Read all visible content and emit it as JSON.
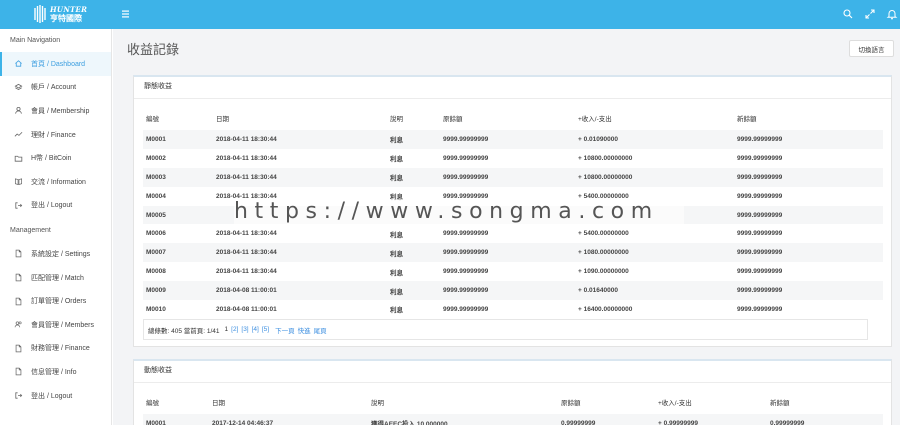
{
  "brand": {
    "name_en": "HUNTER",
    "name_zh": "亨特國際"
  },
  "nav": {
    "section_main": "Main Navigation",
    "section_management": "Management",
    "main_items": [
      {
        "label": "首頁 / Dashboard",
        "icon": "home-icon"
      },
      {
        "label": "帳戶 / Account",
        "icon": "layers-icon"
      },
      {
        "label": "會員 / Membership",
        "icon": "user-icon"
      },
      {
        "label": "理財 / Finance",
        "icon": "trend-icon"
      },
      {
        "label": "H幣 / BitCoin",
        "icon": "folder-icon"
      },
      {
        "label": "交流 / Information",
        "icon": "book-icon"
      },
      {
        "label": "登出 / Logout",
        "icon": "logout-icon"
      }
    ],
    "mgmt_items": [
      {
        "label": "系統設定 / Settings",
        "icon": "file-icon"
      },
      {
        "label": "匹配管理 / Match",
        "icon": "file-icon"
      },
      {
        "label": "訂單管理 / Orders",
        "icon": "file-icon"
      },
      {
        "label": "會員管理 / Members",
        "icon": "people-icon"
      },
      {
        "label": "財務管理 / Finance",
        "icon": "file-icon"
      },
      {
        "label": "信息管理 / Info",
        "icon": "file-icon"
      },
      {
        "label": "登出 / Logout",
        "icon": "logout-icon"
      }
    ]
  },
  "page": {
    "title": "收益記錄",
    "lang_button": "切換語言"
  },
  "static_panel": {
    "title": "靜態收益",
    "headers": [
      "編號",
      "日期",
      "說明",
      "原餘額",
      "+收入/-支出",
      "新餘額"
    ],
    "rows": [
      [
        "M0001",
        "2018-04-11 18:30:44",
        "利息",
        "9999.99999999",
        "+ 0.01090000",
        "9999.99999999"
      ],
      [
        "M0002",
        "2018-04-11 18:30:44",
        "利息",
        "9999.99999999",
        "+ 10800.00000000",
        "9999.99999999"
      ],
      [
        "M0003",
        "2018-04-11 18:30:44",
        "利息",
        "9999.99999999",
        "+ 10800.00000000",
        "9999.99999999"
      ],
      [
        "M0004",
        "2018-04-11 18:30:44",
        "利息",
        "9999.99999999",
        "+ 5400.00000000",
        "9999.99999999"
      ],
      [
        "M0005",
        "",
        "",
        "",
        "",
        "9999.99999999"
      ],
      [
        "M0006",
        "2018-04-11 18:30:44",
        "利息",
        "9999.99999999",
        "+ 5400.00000000",
        "9999.99999999"
      ],
      [
        "M0007",
        "2018-04-11 18:30:44",
        "利息",
        "9999.99999999",
        "+ 1080.00000000",
        "9999.99999999"
      ],
      [
        "M0008",
        "2018-04-11 18:30:44",
        "利息",
        "9999.99999999",
        "+ 1090.00000000",
        "9999.99999999"
      ],
      [
        "M0009",
        "2018-04-08 11:00:01",
        "利息",
        "9999.99999999",
        "+ 0.01640000",
        "9999.99999999"
      ],
      [
        "M0010",
        "2018-04-08 11:00:01",
        "利息",
        "9999.99999999",
        "+ 16400.00000000",
        "9999.99999999"
      ]
    ],
    "pager": {
      "summary": "總條數: 405 當前頁: 1/41",
      "current": "1",
      "pages": [
        "[2]",
        "[3]",
        "[4]",
        "[5]"
      ],
      "next": "下一頁",
      "fast": "快進",
      "last": "尾頁"
    }
  },
  "dynamic_panel": {
    "title": "動態收益",
    "headers": [
      "編號",
      "日期",
      "說明",
      "原餘額",
      "+收入/-支出",
      "新餘額"
    ],
    "rows": [
      [
        "M0001",
        "2017-12-14 04:46:37",
        "獲得AEEC投入 10.000000",
        "0.99999999",
        "+ 0.99999999",
        "0.99999999"
      ]
    ]
  },
  "watermark": "https://www.songma.com"
}
